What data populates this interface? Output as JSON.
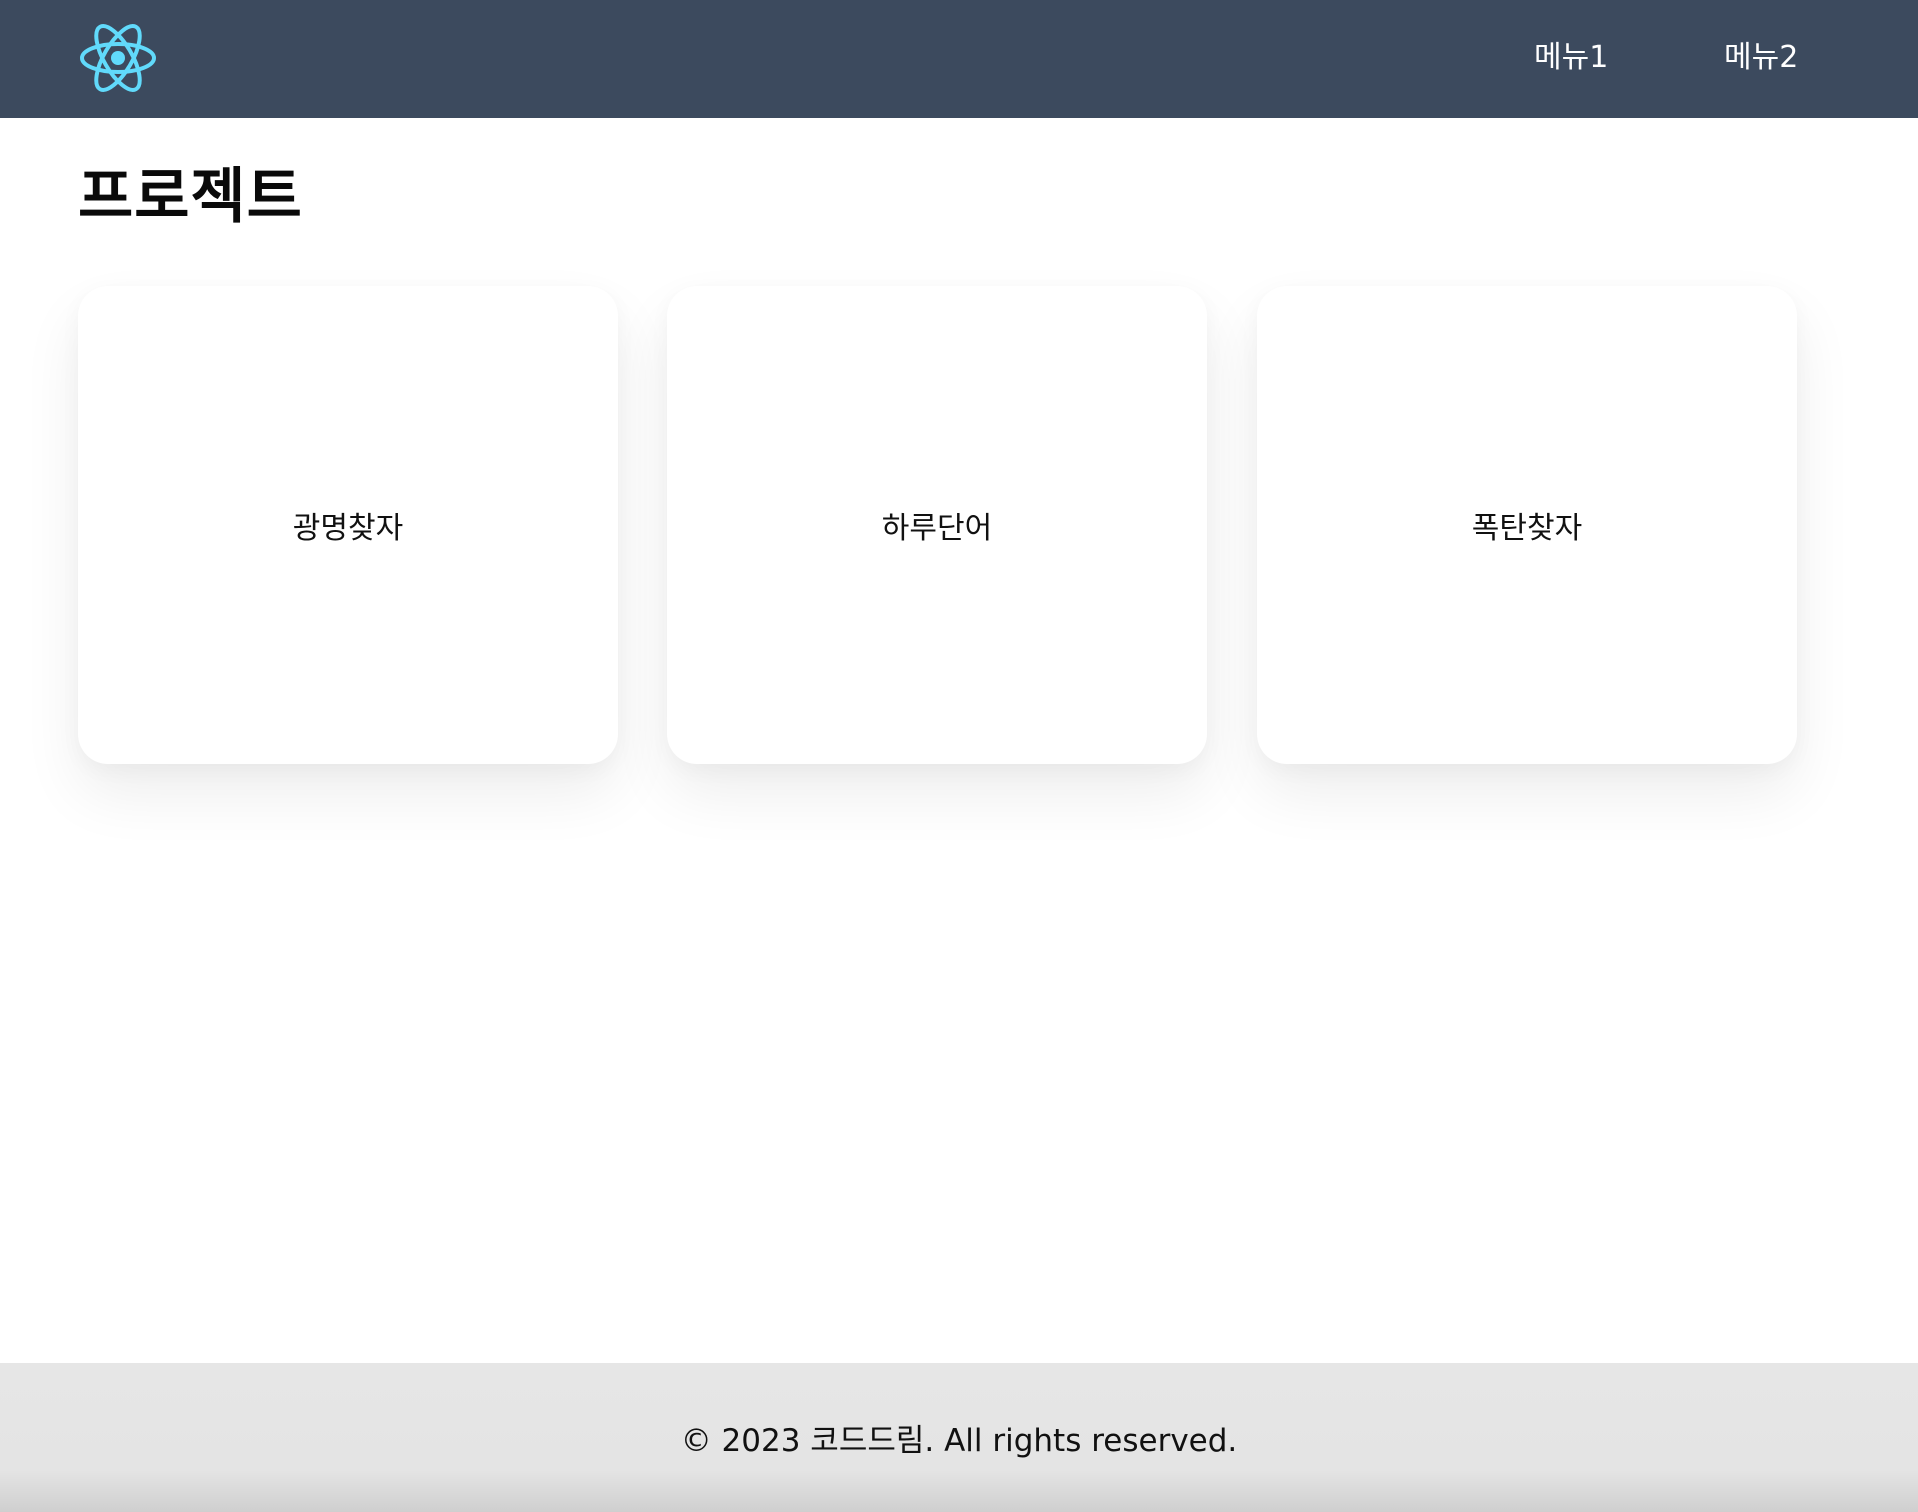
{
  "navbar": {
    "logo_icon": "react-atom-icon",
    "logo_color": "#61dafb",
    "background": "#3c4a5e",
    "links": [
      {
        "label": "메뉴1"
      },
      {
        "label": "메뉴2"
      }
    ]
  },
  "main": {
    "title": "프로젝트",
    "cards": [
      {
        "label": "광명찾자"
      },
      {
        "label": "하루단어"
      },
      {
        "label": "폭탄찾자"
      }
    ]
  },
  "footer": {
    "text": "© 2023 코드드림. All rights reserved."
  }
}
